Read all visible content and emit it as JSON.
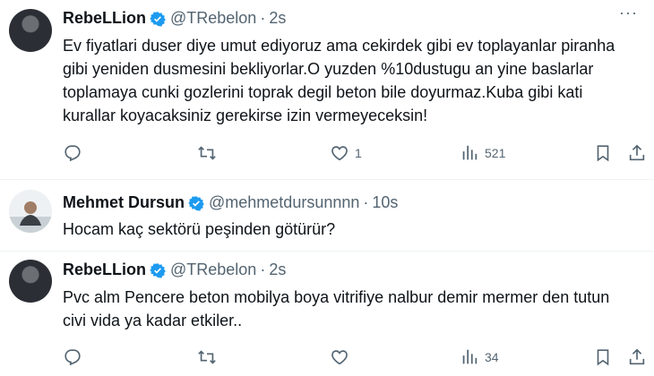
{
  "tweets": [
    {
      "name": "RebeLLion",
      "handle": "@TRebelon",
      "dot": "·",
      "time": "2s",
      "text": "Ev fiyatlari duser diye umut ediyoruz ama cekirdek gibi ev toplayanlar piranha gibi yeniden dusmesini bekliyorlar.O yuzden %10dustugu an yine baslarlar toplamaya cunki gozlerini toprak degil beton bile doyurmaz.Kuba gibi kati kurallar koyacaksiniz gerekirse izin vermeyeceksin!",
      "likes": "1",
      "views": "521"
    },
    {
      "name": "Mehmet Dursun",
      "handle": "@mehmetdursunnnn",
      "dot": "·",
      "time": "10s",
      "text": "Hocam kaç sektörü peşinden götürür?"
    },
    {
      "name": "RebeLLion",
      "handle": "@TRebelon",
      "dot": "·",
      "time": "2s",
      "text": "Pvc alm Pencere beton mobilya boya vitrifiye nalbur demir  mermer den tutun civi vida ya kadar etkiler..",
      "views": "34"
    }
  ],
  "more_label": "···",
  "icons": [
    "reply-icon",
    "retweet-icon",
    "like-icon",
    "views-icon",
    "bookmark-icon",
    "share-icon",
    "verified-badge-icon"
  ],
  "colors": {
    "text": "#0f1419",
    "secondary": "#536471",
    "verified": "#1d9bf0",
    "divider": "#eff3f4"
  }
}
